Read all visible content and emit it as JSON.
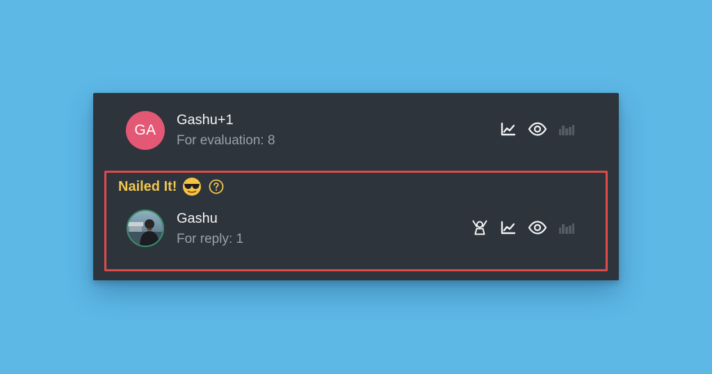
{
  "entries": [
    {
      "avatar_initials": "GA",
      "name": "Gashu+1",
      "status": "For evaluation: 8",
      "avatar_color": "#e35875"
    },
    {
      "name": "Gashu",
      "status": "For reply: 1",
      "avatar_type": "photo"
    }
  ],
  "badge": {
    "title": "Nailed It!",
    "emoji": "sunglasses-face",
    "help_icon": "question-circle-icon"
  },
  "icons": {
    "row1": [
      "trend-chart-icon",
      "eye-icon",
      "bar-chart-icon"
    ],
    "row2": [
      "person-podium-icon",
      "trend-chart-icon",
      "eye-icon",
      "bar-chart-icon"
    ]
  },
  "colors": {
    "page_background": "#5db8e6",
    "card_background": "#2e343b",
    "highlight_border": "#df4b4b",
    "badge_text": "#f0c64f"
  }
}
